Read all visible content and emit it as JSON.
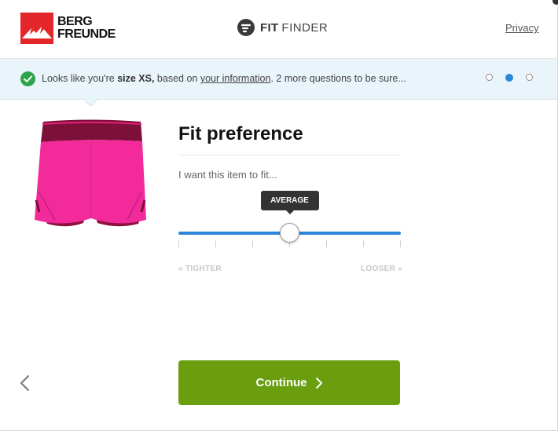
{
  "header": {
    "brand_line1": "BERG",
    "brand_line2": "FREUNDE",
    "app_name_bold": "FIT",
    "app_name_light": "FINDER",
    "privacy_label": "Privacy"
  },
  "banner": {
    "prefix": "Looks like you're ",
    "size": "size XS,",
    "middle": " based on ",
    "link": "your information",
    "suffix": ". 2 more questions to be sure...",
    "steps": [
      {
        "state": "inactive"
      },
      {
        "state": "active"
      },
      {
        "state": "inactive"
      }
    ]
  },
  "product": {
    "icon": "skirt-product-image",
    "color": "#f22a9a"
  },
  "question": {
    "title": "Fit preference",
    "subtitle": "I want this item to fit...",
    "slider": {
      "selected_label": "AVERAGE",
      "value_fraction": 0.5,
      "tick_count": 7,
      "min_label": "« TIGHTER",
      "max_label": "LOOSER »"
    }
  },
  "footer": {
    "back_icon": "chevron-left-icon",
    "continue_label": "Continue",
    "continue_color": "#6a9e0f"
  },
  "colors": {
    "accent": "#2b86d9",
    "success": "#2ca44a",
    "brand": "#e3262a"
  }
}
